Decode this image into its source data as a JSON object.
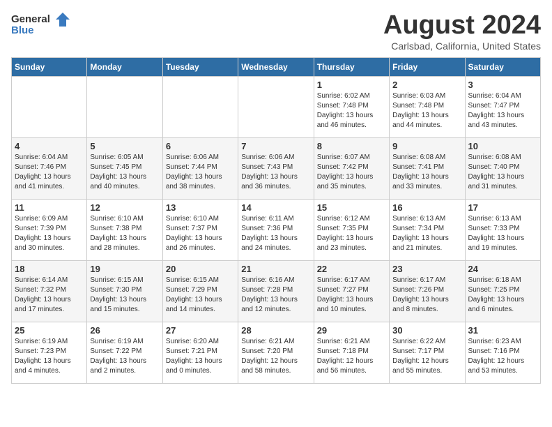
{
  "header": {
    "logo_general": "General",
    "logo_blue": "Blue",
    "title": "August 2024",
    "subtitle": "Carlsbad, California, United States"
  },
  "calendar": {
    "days_of_week": [
      "Sunday",
      "Monday",
      "Tuesday",
      "Wednesday",
      "Thursday",
      "Friday",
      "Saturday"
    ],
    "weeks": [
      [
        {
          "day": "",
          "info": ""
        },
        {
          "day": "",
          "info": ""
        },
        {
          "day": "",
          "info": ""
        },
        {
          "day": "",
          "info": ""
        },
        {
          "day": "1",
          "info": "Sunrise: 6:02 AM\nSunset: 7:48 PM\nDaylight: 13 hours\nand 46 minutes."
        },
        {
          "day": "2",
          "info": "Sunrise: 6:03 AM\nSunset: 7:48 PM\nDaylight: 13 hours\nand 44 minutes."
        },
        {
          "day": "3",
          "info": "Sunrise: 6:04 AM\nSunset: 7:47 PM\nDaylight: 13 hours\nand 43 minutes."
        }
      ],
      [
        {
          "day": "4",
          "info": "Sunrise: 6:04 AM\nSunset: 7:46 PM\nDaylight: 13 hours\nand 41 minutes."
        },
        {
          "day": "5",
          "info": "Sunrise: 6:05 AM\nSunset: 7:45 PM\nDaylight: 13 hours\nand 40 minutes."
        },
        {
          "day": "6",
          "info": "Sunrise: 6:06 AM\nSunset: 7:44 PM\nDaylight: 13 hours\nand 38 minutes."
        },
        {
          "day": "7",
          "info": "Sunrise: 6:06 AM\nSunset: 7:43 PM\nDaylight: 13 hours\nand 36 minutes."
        },
        {
          "day": "8",
          "info": "Sunrise: 6:07 AM\nSunset: 7:42 PM\nDaylight: 13 hours\nand 35 minutes."
        },
        {
          "day": "9",
          "info": "Sunrise: 6:08 AM\nSunset: 7:41 PM\nDaylight: 13 hours\nand 33 minutes."
        },
        {
          "day": "10",
          "info": "Sunrise: 6:08 AM\nSunset: 7:40 PM\nDaylight: 13 hours\nand 31 minutes."
        }
      ],
      [
        {
          "day": "11",
          "info": "Sunrise: 6:09 AM\nSunset: 7:39 PM\nDaylight: 13 hours\nand 30 minutes."
        },
        {
          "day": "12",
          "info": "Sunrise: 6:10 AM\nSunset: 7:38 PM\nDaylight: 13 hours\nand 28 minutes."
        },
        {
          "day": "13",
          "info": "Sunrise: 6:10 AM\nSunset: 7:37 PM\nDaylight: 13 hours\nand 26 minutes."
        },
        {
          "day": "14",
          "info": "Sunrise: 6:11 AM\nSunset: 7:36 PM\nDaylight: 13 hours\nand 24 minutes."
        },
        {
          "day": "15",
          "info": "Sunrise: 6:12 AM\nSunset: 7:35 PM\nDaylight: 13 hours\nand 23 minutes."
        },
        {
          "day": "16",
          "info": "Sunrise: 6:13 AM\nSunset: 7:34 PM\nDaylight: 13 hours\nand 21 minutes."
        },
        {
          "day": "17",
          "info": "Sunrise: 6:13 AM\nSunset: 7:33 PM\nDaylight: 13 hours\nand 19 minutes."
        }
      ],
      [
        {
          "day": "18",
          "info": "Sunrise: 6:14 AM\nSunset: 7:32 PM\nDaylight: 13 hours\nand 17 minutes."
        },
        {
          "day": "19",
          "info": "Sunrise: 6:15 AM\nSunset: 7:30 PM\nDaylight: 13 hours\nand 15 minutes."
        },
        {
          "day": "20",
          "info": "Sunrise: 6:15 AM\nSunset: 7:29 PM\nDaylight: 13 hours\nand 14 minutes."
        },
        {
          "day": "21",
          "info": "Sunrise: 6:16 AM\nSunset: 7:28 PM\nDaylight: 13 hours\nand 12 minutes."
        },
        {
          "day": "22",
          "info": "Sunrise: 6:17 AM\nSunset: 7:27 PM\nDaylight: 13 hours\nand 10 minutes."
        },
        {
          "day": "23",
          "info": "Sunrise: 6:17 AM\nSunset: 7:26 PM\nDaylight: 13 hours\nand 8 minutes."
        },
        {
          "day": "24",
          "info": "Sunrise: 6:18 AM\nSunset: 7:25 PM\nDaylight: 13 hours\nand 6 minutes."
        }
      ],
      [
        {
          "day": "25",
          "info": "Sunrise: 6:19 AM\nSunset: 7:23 PM\nDaylight: 13 hours\nand 4 minutes."
        },
        {
          "day": "26",
          "info": "Sunrise: 6:19 AM\nSunset: 7:22 PM\nDaylight: 13 hours\nand 2 minutes."
        },
        {
          "day": "27",
          "info": "Sunrise: 6:20 AM\nSunset: 7:21 PM\nDaylight: 13 hours\nand 0 minutes."
        },
        {
          "day": "28",
          "info": "Sunrise: 6:21 AM\nSunset: 7:20 PM\nDaylight: 12 hours\nand 58 minutes."
        },
        {
          "day": "29",
          "info": "Sunrise: 6:21 AM\nSunset: 7:18 PM\nDaylight: 12 hours\nand 56 minutes."
        },
        {
          "day": "30",
          "info": "Sunrise: 6:22 AM\nSunset: 7:17 PM\nDaylight: 12 hours\nand 55 minutes."
        },
        {
          "day": "31",
          "info": "Sunrise: 6:23 AM\nSunset: 7:16 PM\nDaylight: 12 hours\nand 53 minutes."
        }
      ]
    ]
  }
}
